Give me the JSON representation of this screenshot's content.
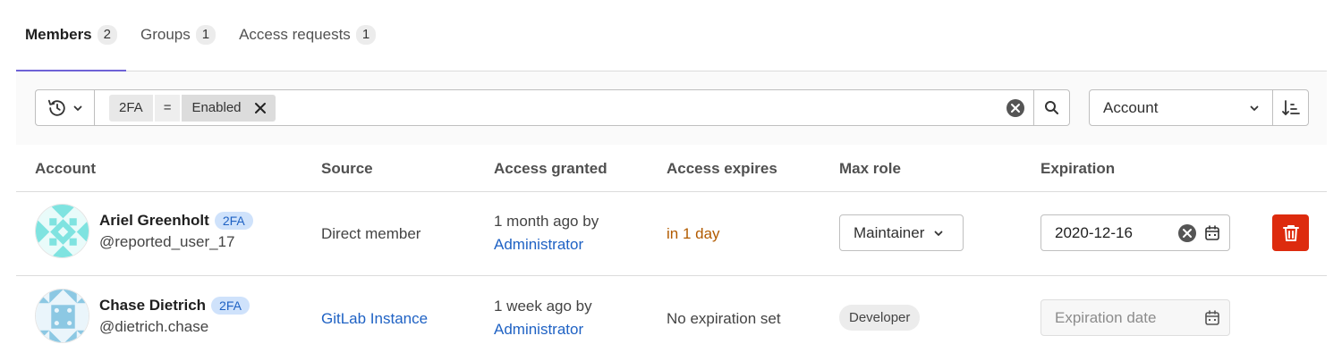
{
  "tabs": [
    {
      "label": "Members",
      "count": "2",
      "active": true
    },
    {
      "label": "Groups",
      "count": "1",
      "active": false
    },
    {
      "label": "Access requests",
      "count": "1",
      "active": false
    }
  ],
  "filter": {
    "token_key": "2FA",
    "token_operator": "=",
    "token_value": "Enabled"
  },
  "sort": {
    "selected": "Account"
  },
  "table": {
    "headers": [
      "Account",
      "Source",
      "Access granted",
      "Access expires",
      "Max role",
      "Expiration"
    ],
    "rows": [
      {
        "name": "Ariel Greenholt",
        "badge": "2FA",
        "username": "@reported_user_17",
        "source": "Direct member",
        "granted_time": "1 month ago by",
        "granted_by": "Administrator",
        "expires": "in 1 day",
        "role": "Maintainer",
        "expiration": "2020-12-16"
      },
      {
        "name": "Chase Dietrich",
        "badge": "2FA",
        "username": "@dietrich.chase",
        "source": "GitLab Instance",
        "granted_time": "1 week ago by",
        "granted_by": "Administrator",
        "expires": "No expiration set",
        "role": "Developer",
        "expiration_placeholder": "Expiration date"
      }
    ]
  },
  "colors": {
    "accent_tab": "#6e62d6",
    "link": "#1f62c4",
    "warning": "#b25b00",
    "danger": "#dd2b0e",
    "badge_2fa_bg": "#cfe2fb"
  },
  "icons": [
    "history-icon",
    "chevron-down-icon",
    "close-icon",
    "clear-icon",
    "search-icon",
    "sort-ascending-icon",
    "calendar-icon",
    "trash-icon"
  ]
}
